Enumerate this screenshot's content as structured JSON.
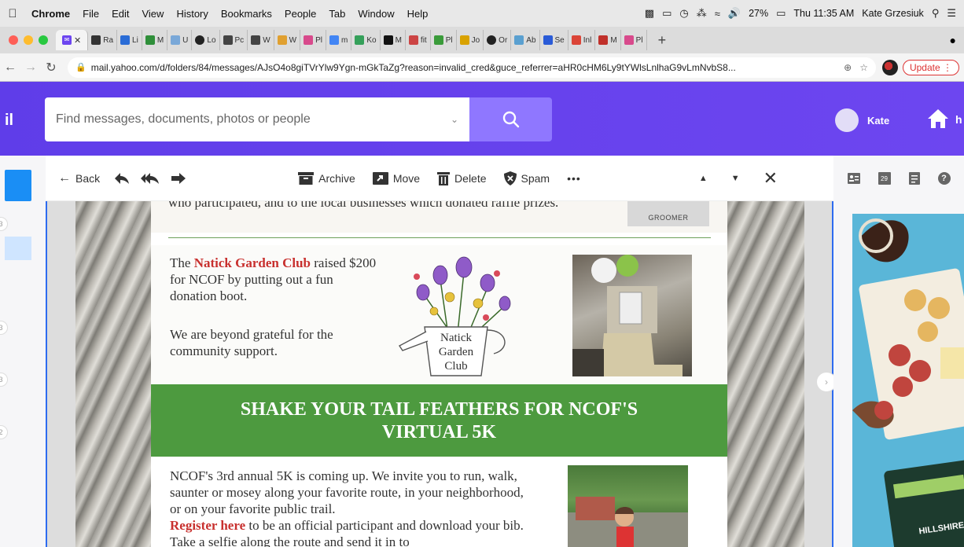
{
  "menubar": {
    "app_name": "Chrome",
    "menus": [
      "File",
      "Edit",
      "View",
      "History",
      "Bookmarks",
      "People",
      "Tab",
      "Window",
      "Help"
    ],
    "battery": "27%",
    "clock": "Thu 11:35 AM",
    "user": "Kate Grzesiuk"
  },
  "tabs": {
    "active_label": "",
    "items": [
      "Ra",
      "Li",
      "M",
      "U",
      "Lo",
      "Pc",
      "W",
      "W",
      "Pl",
      "m",
      "Ko",
      "M",
      "fit",
      "Pl",
      "Jo",
      "Or",
      "Ab",
      "Se",
      "Inl",
      "M",
      "Pl"
    ],
    "new_tab": "+"
  },
  "address": {
    "url": "mail.yahoo.com/d/folders/84/messages/AJsO4o8giTVrYlw9Ygn-mGkTaZg?reason=invalid_cred&guce_referrer=aHR0cHM6Ly9tYWlsLnlhaG9vLmNvbS8...",
    "update_label": "Update"
  },
  "header": {
    "logo_fragment": "il",
    "search_placeholder": "Find messages, documents, photos or people",
    "user_name": "Kate",
    "home_fragment": "h"
  },
  "rail": {
    "badges": [
      "3",
      "3",
      "3",
      "2"
    ]
  },
  "toolbar": {
    "back": "Back",
    "archive": "Archive",
    "move": "Move",
    "delete": "Delete",
    "spam": "Spam",
    "more": "•••"
  },
  "message": {
    "top_text": "who participated, and to the local businesses which donated raffle prizes.",
    "groomer_label": "GROOMER",
    "club_prefix": "The ",
    "club_name": "Natick Garden Club",
    "club_suffix": " raised $200 for NCOF by putting out a fun donation boot.",
    "gratitude": "We are beyond grateful for the community support.",
    "logo_line1": "Natick",
    "logo_line2": "Garden",
    "logo_line3": "Club",
    "banner_line1": "SHAKE YOUR TAIL FEATHERS FOR NCOF'S",
    "banner_line2": "VIRTUAL 5K",
    "run_intro": "NCOF's 3rd annual 5K is coming up. We invite you to run, walk, saunter or mosey along your favorite route, in your neighborhood, or on your favorite public trail.",
    "register_link": "Register here",
    "register_tail": " to be an official participant and download your bib. Take a selfie along the route and send it in to"
  },
  "right_rail": {
    "calendar_day": "29",
    "ad_brand": "HILLSHIRE"
  },
  "colors": {
    "yahoo_purple": "#6d46f0",
    "banner_green": "#4d9a3f",
    "link_red": "#c8302e",
    "select_blue": "#2d6bf0"
  }
}
